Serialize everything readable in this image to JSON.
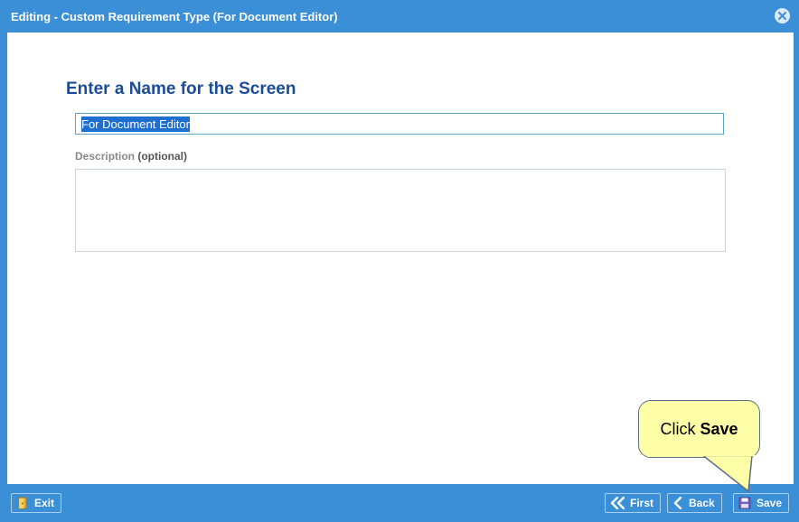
{
  "window": {
    "title": "Editing - Custom Requirement Type (For Document Editor)"
  },
  "form": {
    "heading": "Enter a Name for the Screen",
    "name_value": "For Document Editor",
    "description_label": "Description",
    "description_optional": "(optional)",
    "description_value": ""
  },
  "footer": {
    "exit_label": "Exit",
    "first_label": "First",
    "back_label": "Back",
    "save_label": "Save"
  },
  "callout": {
    "prefix": "Click ",
    "bold": "Save"
  },
  "colors": {
    "chrome": "#3a8fd6",
    "heading": "#1a4c97",
    "selection": "#1e6fd0",
    "callout_bg": "#ffffa8"
  },
  "icons": {
    "close": "close-circle-icon",
    "exit": "exit-door-icon",
    "first": "double-chevron-left-icon",
    "back": "chevron-left-icon",
    "save": "floppy-disk-icon"
  }
}
